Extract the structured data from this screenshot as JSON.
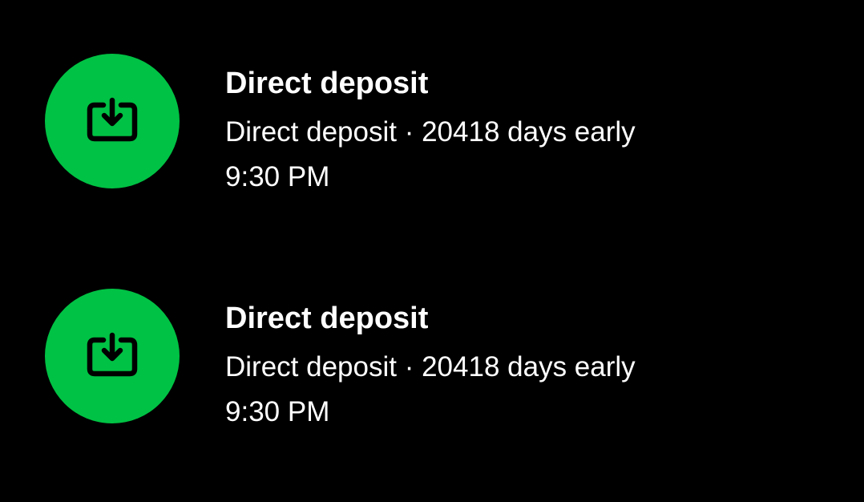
{
  "theme": {
    "background": "#000000",
    "accent": "#00C244",
    "text": "#FFFFFF",
    "icon_stroke": "#000000"
  },
  "transactions": [
    {
      "icon": "deposit-icon",
      "title": "Direct deposit",
      "subtitle": "Direct deposit · 20418 days early",
      "time": "9:30 PM"
    },
    {
      "icon": "deposit-icon",
      "title": "Direct deposit",
      "subtitle": "Direct deposit · 20418 days early",
      "time": "9:30 PM"
    }
  ]
}
